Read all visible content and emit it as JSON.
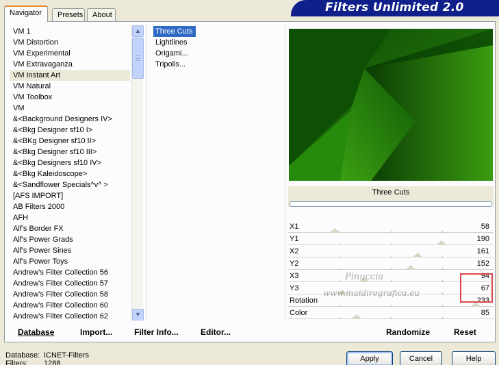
{
  "tabs": [
    {
      "label": "Navigator",
      "active": true
    },
    {
      "label": "Presets",
      "active": false
    },
    {
      "label": "About",
      "active": false
    }
  ],
  "title": "Filters Unlimited 2.0",
  "categories": [
    "VM 1",
    "VM Distortion",
    "VM Experimental",
    "VM Extravaganza",
    "VM Instant Art",
    "VM Natural",
    "VM Toolbox",
    "VM",
    "&<Background Designers IV>",
    "&<Bkg Designer sf10 I>",
    "&<BKg Designer sf10 II>",
    "&<Bkg Designer sf10 III>",
    "&<Bkg Designers sf10 IV>",
    "&<Bkg Kaleidoscope>",
    "&<Sandflower Specials^v^ >",
    "[AFS IMPORT]",
    "AB Filters 2000",
    "AFH",
    "Alf's Border FX",
    "Alf's Power Grads",
    "Alf's Power Sines",
    "Alf's Power Toys",
    "Andrew's Filter Collection 56",
    "Andrew's Filter Collection 57",
    "Andrew's Filter Collection 58",
    "Andrew's Filter Collection 60",
    "Andrew's Filter Collection 62"
  ],
  "selected_category": "VM Instant Art",
  "filters": [
    "Three Cuts",
    "Lightlines",
    "Origami...",
    "Tripolis..."
  ],
  "selected_filter": "Three Cuts",
  "preview": {
    "filter_name": "Three Cuts",
    "progress": 0
  },
  "params": [
    {
      "label": "X1",
      "value": "58",
      "fraction": 0.2275
    },
    {
      "label": "Y1",
      "value": "190",
      "fraction": 0.745
    },
    {
      "label": "X2",
      "value": "161",
      "fraction": 0.631
    },
    {
      "label": "Y2",
      "value": "152",
      "fraction": 0.596
    },
    {
      "label": "X3",
      "value": "94",
      "fraction": 0.369
    },
    {
      "label": "Y3",
      "value": "67",
      "fraction": 0.263
    },
    {
      "label": "Rotation",
      "value": "233",
      "fraction": 0.914
    },
    {
      "label": "Color",
      "value": "85",
      "fraction": 0.333
    }
  ],
  "watermark": {
    "line1": "Pinuccia",
    "line2": "www.maidiregrafica.eu"
  },
  "bottom_links": {
    "database": "Database",
    "import": "Import...",
    "filter_info": "Filter Info...",
    "editor": "Editor...",
    "randomize": "Randomize",
    "reset": "Reset"
  },
  "status": {
    "database_label": "Database:",
    "database_value": "ICNET-Filters",
    "filters_label": "Filters:",
    "filters_value": "1288"
  },
  "buttons": {
    "apply": "Apply",
    "cancel": "Cancel",
    "help": "Help"
  },
  "colors": {
    "selection": "#316ac5",
    "tab_accent": "#e68b2c",
    "title_banner": "#10208a",
    "highlight": "#d84a4a"
  }
}
